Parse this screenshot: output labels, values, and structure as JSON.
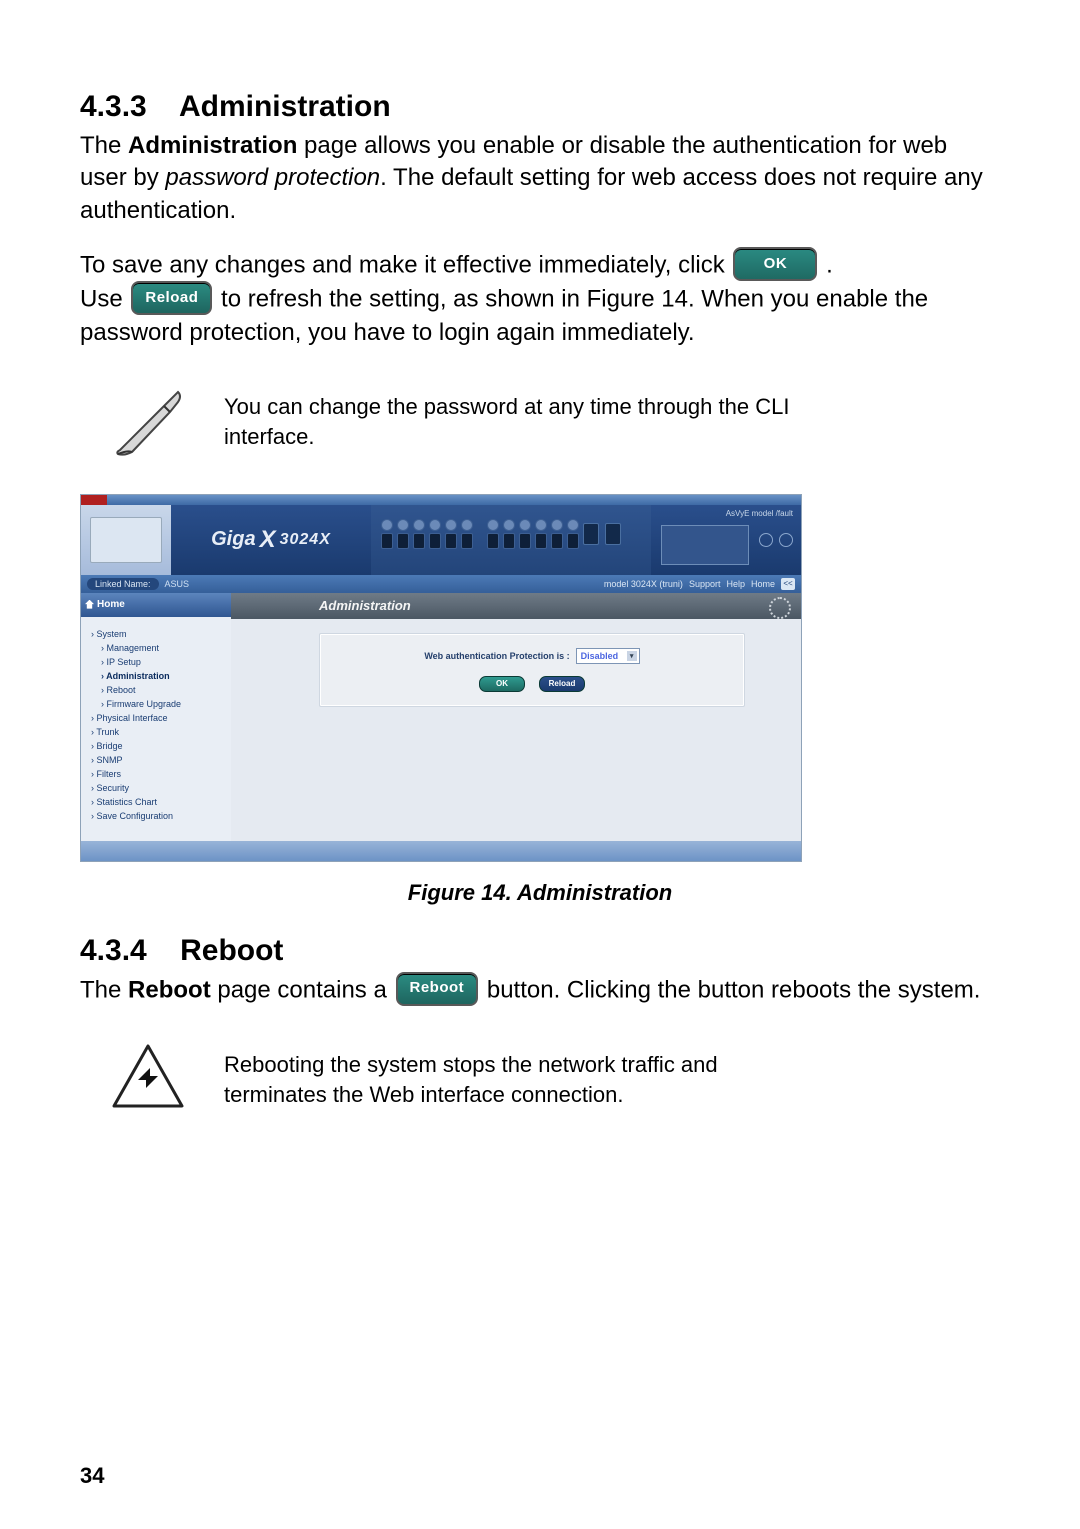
{
  "sections": {
    "admin": {
      "number": "4.3.3",
      "title": "Administration",
      "p1_a": "The ",
      "p1_bold": "Administration",
      "p1_b": " page allows you enable or disable the authentication for web user by ",
      "p1_italic": "password protection",
      "p1_c": ". The default setting for web access does not require any authentication.",
      "p2_a": "To save any changes and make it effective immediately, click ",
      "p2_b": ".",
      "p3_a": "Use ",
      "p3_b": " to refresh the setting, as shown in Figure 14. When you enable the password protection, you have to login again immediately.",
      "note": "You can change the password at any time through the CLI interface."
    },
    "reboot": {
      "number": "4.3.4",
      "title": "Reboot",
      "p1_a": "The ",
      "p1_bold": "Reboot",
      "p1_b": " page contains a ",
      "p1_c": " button. Clicking the button reboots the system.",
      "warn": "Rebooting the system stops the network traffic and terminates the Web interface connection."
    }
  },
  "buttons": {
    "ok": "OK",
    "reload": "Reload",
    "reboot": "Reboot"
  },
  "figure": {
    "caption": "Figure 14.   Administration",
    "logo_a": "Giga",
    "logo_b": "3024X",
    "bar_left_label": "Linked Name:",
    "bar_left_value": "ASUS",
    "bar_right_model": "model 3024X (truni)",
    "bar_links": [
      "Support",
      "Help",
      "Home"
    ],
    "bar_page": "<<",
    "top_right": "AsVyE model  /fault",
    "nav_home": "Home",
    "nav_items": [
      {
        "label": "System",
        "sub": false
      },
      {
        "label": "Management",
        "sub": true
      },
      {
        "label": "IP Setup",
        "sub": true
      },
      {
        "label": "Administration",
        "sub": true,
        "active": true
      },
      {
        "label": "Reboot",
        "sub": true
      },
      {
        "label": "Firmware Upgrade",
        "sub": true
      },
      {
        "label": "Physical Interface",
        "sub": false
      },
      {
        "label": "Trunk",
        "sub": false
      },
      {
        "label": "Bridge",
        "sub": false
      },
      {
        "label": "SNMP",
        "sub": false
      },
      {
        "label": "Filters",
        "sub": false
      },
      {
        "label": "Security",
        "sub": false
      },
      {
        "label": "Statistics Chart",
        "sub": false
      },
      {
        "label": "Save Configuration",
        "sub": false
      }
    ],
    "section_head": "Administration",
    "form_label": "Web authentication Protection is :",
    "form_value": "Disabled",
    "btn_ok": "OK",
    "btn_reload": "Reload"
  },
  "page_number": "34"
}
